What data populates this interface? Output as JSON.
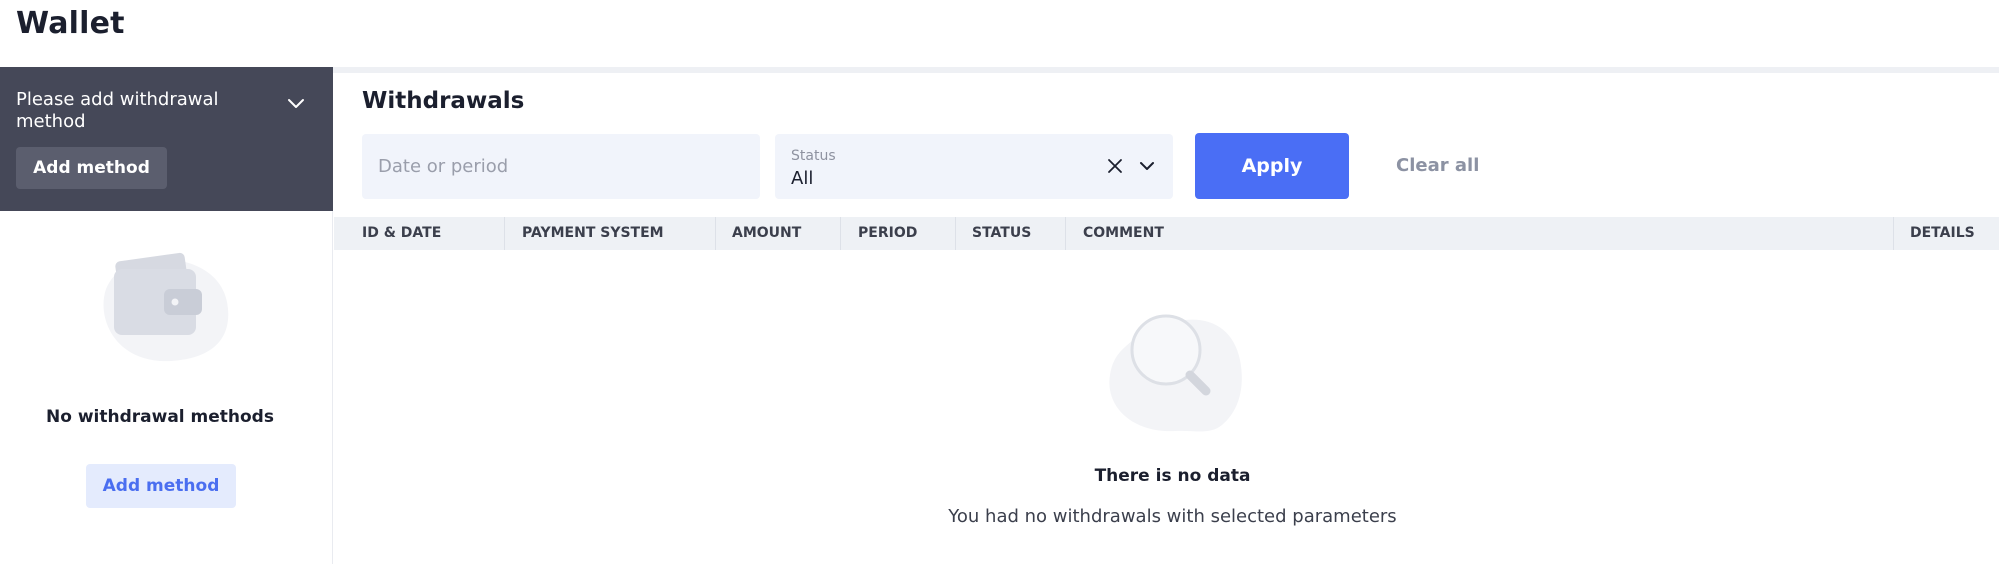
{
  "page": {
    "title": "Wallet"
  },
  "sidebar": {
    "banner_text": "Please add withdrawal method",
    "banner_button": "Add method",
    "empty_title": "No withdrawal methods",
    "empty_button": "Add method"
  },
  "main": {
    "title": "Withdrawals",
    "filters": {
      "date_placeholder": "Date or period",
      "status_label": "Status",
      "status_value": "All",
      "apply": "Apply",
      "clear_all": "Clear all"
    },
    "table": {
      "columns": [
        "ID & DATE",
        "PAYMENT SYSTEM",
        "AMOUNT",
        "PERIOD",
        "STATUS",
        "COMMENT",
        "DETAILS"
      ]
    },
    "empty": {
      "title": "There is no data",
      "subtitle": "You had no withdrawals with selected parameters"
    }
  },
  "colors": {
    "accent": "#4a6ef5",
    "banner": "#454858"
  },
  "icons": [
    "chevron-down-icon",
    "wallet-icon",
    "close-icon",
    "search-icon"
  ]
}
